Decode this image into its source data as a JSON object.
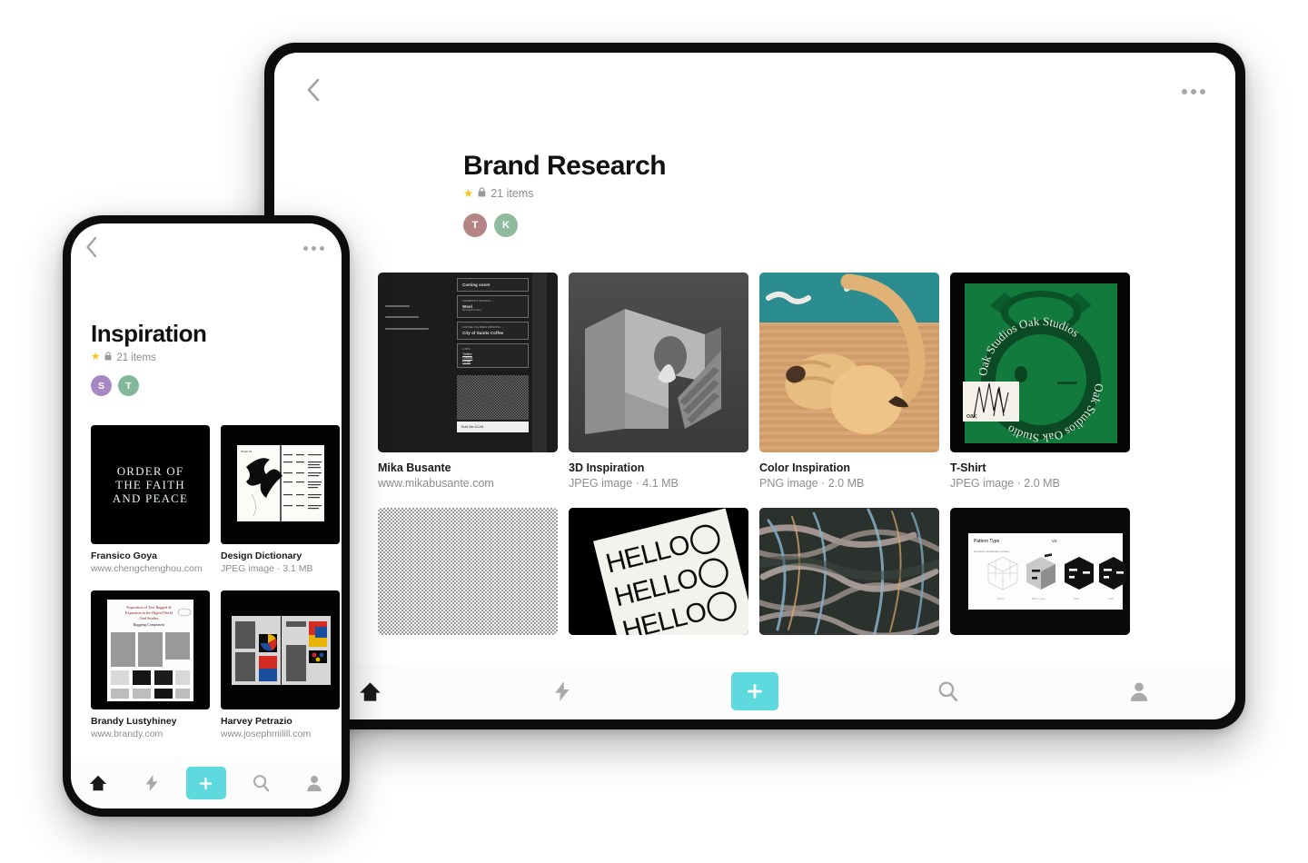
{
  "accent_color": "#5ed9dd",
  "tablet": {
    "topbar": {
      "back_label": "Back",
      "menu_label": "More options"
    },
    "board": {
      "title": "Brand Research",
      "items_count": "21 items",
      "star": "★",
      "members": [
        {
          "initial": "T",
          "color": "#b58585"
        },
        {
          "initial": "K",
          "color": "#8ebb9e"
        }
      ]
    },
    "grid": [
      {
        "name": "Mika Busante",
        "sub": "www.mikabusante.com",
        "art": "site",
        "wide": false
      },
      {
        "name": "3D Inspiration",
        "sub": "JPEG image · 4.1 MB",
        "art": "3d",
        "wide": false
      },
      {
        "name": "Color Inspiration",
        "sub": "PNG image · 2.0 MB",
        "art": "color",
        "wide": false
      },
      {
        "name": "T-Shirt",
        "sub": "JPEG image · 2.0 MB",
        "art": "tee",
        "wide": false
      },
      {
        "name": "",
        "sub": "",
        "art": "halftone",
        "wide": true
      },
      {
        "name": "",
        "sub": "",
        "art": "hello",
        "wide": true
      },
      {
        "name": "",
        "sub": "",
        "art": "paint",
        "wide": true
      },
      {
        "name": "",
        "sub": "",
        "art": "slide",
        "wide": true
      }
    ],
    "nav": [
      {
        "icon": "home-icon",
        "active": true
      },
      {
        "icon": "bolt-icon",
        "active": false
      },
      {
        "icon": "plus-icon",
        "active": false
      },
      {
        "icon": "search-icon",
        "active": false
      },
      {
        "icon": "profile-icon",
        "active": false
      }
    ]
  },
  "phone": {
    "topbar": {
      "back_label": "Back",
      "menu_label": "More options"
    },
    "board": {
      "title": "Inspiration",
      "items_count": "21 items",
      "star": "★",
      "members": [
        {
          "initial": "S",
          "color": "#a888c4"
        },
        {
          "initial": "T",
          "color": "#82b79a"
        }
      ]
    },
    "grid": [
      {
        "name": "Fransico Goya",
        "sub": "www.chengchenghou.com",
        "art": "order"
      },
      {
        "name": "Design Dictionary",
        "sub": "JPEG image · 3.1 MB",
        "art": "dict"
      },
      {
        "name": "Brandy Lustyhiney",
        "sub": "www.brandy.com",
        "art": "doc1"
      },
      {
        "name": "Harvey Petrazio",
        "sub": "www.josephmilill.com",
        "art": "doc2"
      }
    ],
    "art_text": {
      "order_line1": "ORDER OF",
      "order_line2": "THE FAITH",
      "order_line3": "AND PEACE"
    },
    "nav": [
      {
        "icon": "home-icon",
        "active": true
      },
      {
        "icon": "bolt-icon",
        "active": false
      },
      {
        "icon": "plus-icon",
        "active": false
      },
      {
        "icon": "search-icon",
        "active": false
      },
      {
        "icon": "profile-icon",
        "active": false
      }
    ]
  },
  "art_labels": {
    "site_coming_soon": "Coming soon!",
    "site_currently_reading": "CURRENTLY READING →",
    "site_wool": "Wool",
    "site_wool_by": "By Hugh Howey",
    "site_coffee_label": "COFFEE I'VE BEEN DRINKING →",
    "site_coffee": "City of Saints Coffee",
    "site_links": "LINKS →",
    "site_twitter": "Twitter",
    "site_github": "GitHub",
    "site_email": "Email",
    "site_footer": "Built like ACAB.",
    "hello_word": "HELLO",
    "tee_brand": "Oak Studios",
    "slide_title": "Pattern Type",
    "slide_version": "V2",
    "slide_sub": "Isometric perspective content",
    "slide_items": [
      "Frame",
      "Blend + Line",
      "Solid",
      "Solid"
    ]
  }
}
